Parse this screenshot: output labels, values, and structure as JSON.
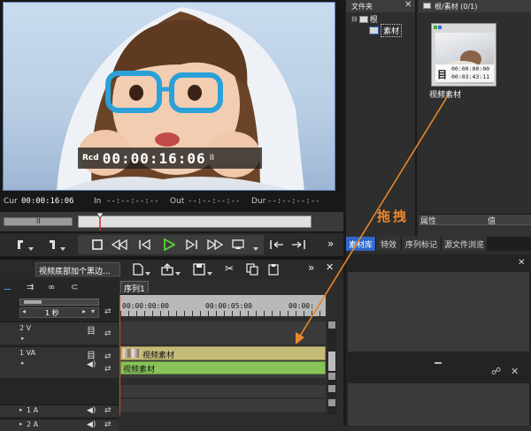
{
  "player": {
    "rcd_label": "Rcd",
    "rcd_timecode": "00:00:16:06",
    "rcd_flag": "II",
    "status": [
      {
        "label": "Cur",
        "value": "00:00:16:06"
      },
      {
        "label": "In",
        "value": "--:--:--:--"
      },
      {
        "label": "Out",
        "value": "--:--:--:--"
      },
      {
        "label": "Dur",
        "value": "--:--:--:--"
      }
    ],
    "scrubber_flag": "II",
    "scrub_position": 0.09
  },
  "folder_panel": {
    "title": "文件夹",
    "root_label": "根",
    "child_label": "素材"
  },
  "bin_panel": {
    "title": "根/素材 (0/1)",
    "clip": {
      "tc_in": "00:00:00:00",
      "tc_dur": "00:03:43:11",
      "name": "视频素材"
    },
    "prop_header": "属性",
    "value_header": "值",
    "tabs": [
      "素材库",
      "特效",
      "序列标记",
      "源文件浏览"
    ]
  },
  "annotation": {
    "drag_text": "拖拽",
    "color": "#e8862a"
  },
  "timeline": {
    "sequence_name": "视频底部加个黑边...",
    "sequence_tab": "序列1",
    "scale_label": "1 秒",
    "ruler": [
      "00:00:00:00",
      "00:00:05:00",
      "00:00:"
    ],
    "tracks": [
      {
        "name": "2 V"
      },
      {
        "name": "1 VA"
      },
      {
        "name": "1 A"
      },
      {
        "name": "2 A"
      }
    ],
    "clip_video": "视频素材",
    "clip_audio": "视频素材"
  },
  "colors": {
    "accent_blue": "#2f67c9",
    "play_green": "#5bd33a",
    "clip_video": "#c4bb78",
    "clip_audio": "#8ac25a"
  }
}
